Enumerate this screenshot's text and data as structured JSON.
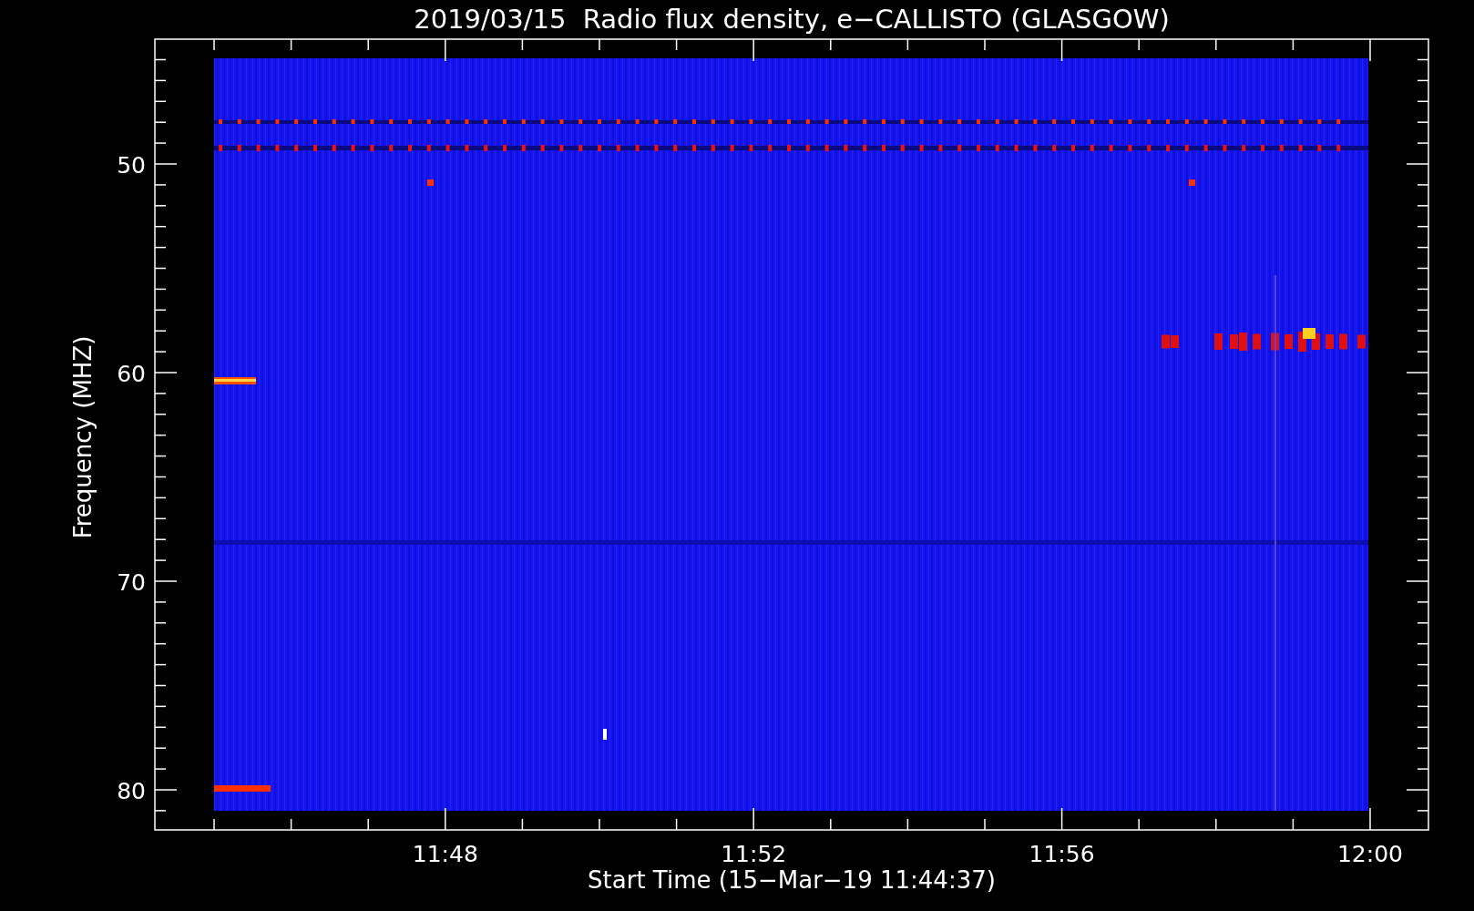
{
  "title": "2019/03/15  Radio flux density, e−CALLISTO (GLASGOW)",
  "ylabel": "Frequency (MHZ)",
  "xlabel": "Start Time (15−Mar−19 11:44:37)",
  "yticks": [
    "50",
    "60",
    "70",
    "80"
  ],
  "xticks": [
    "11:48",
    "11:52",
    "11:56",
    "12:00"
  ]
}
